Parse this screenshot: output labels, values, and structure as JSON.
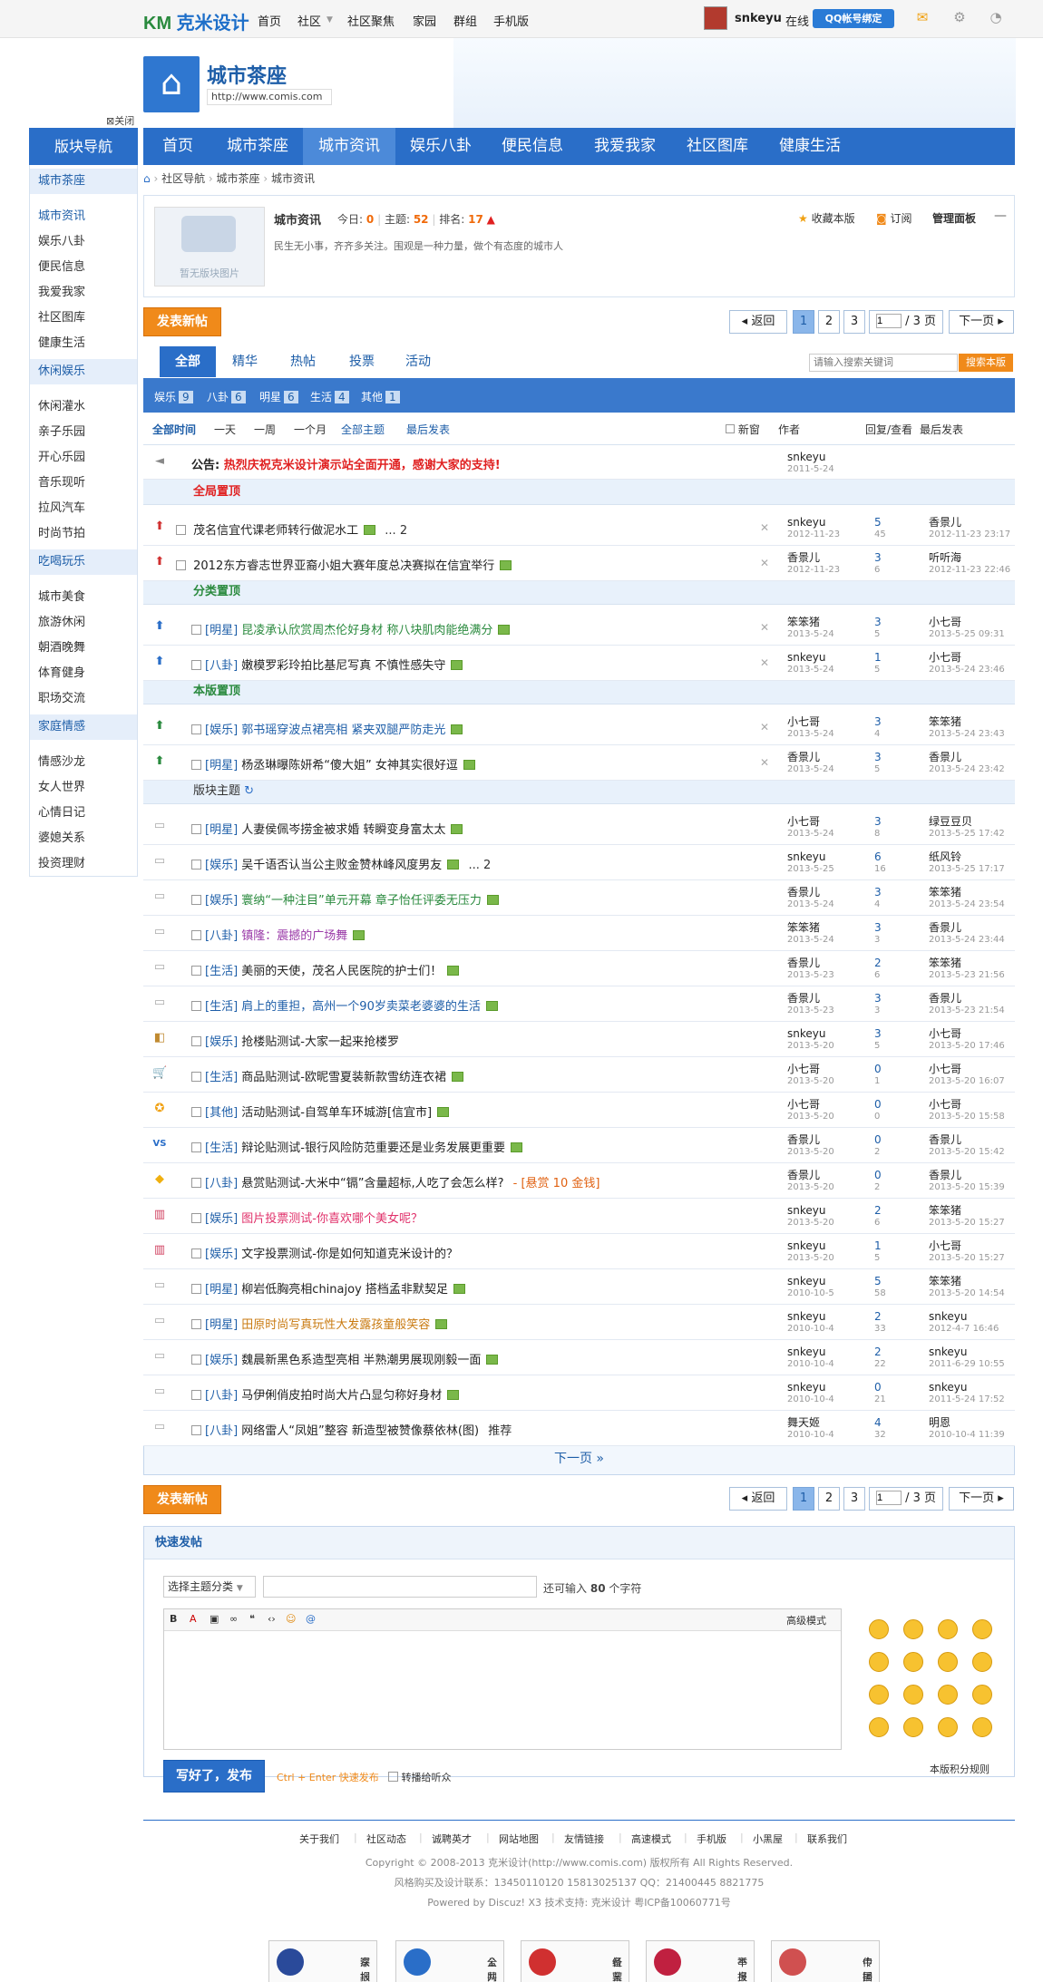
{
  "topbar": {
    "logo": "克米设计",
    "nav": [
      "首页",
      "社区",
      "社区聚焦",
      "家园",
      "群组",
      "手机版"
    ],
    "username": "snkeyu",
    "online": "在线",
    "qq_bind": "QQ帐号绑定"
  },
  "header": {
    "forum_name": "城市茶座",
    "url": "http://www.comis.com",
    "close": "关闭"
  },
  "mainnav": [
    "首页",
    "城市茶座",
    "城市资讯",
    "娱乐八卦",
    "便民信息",
    "我爱我家",
    "社区图库",
    "健康生活"
  ],
  "sidebar": {
    "title": "版块导航",
    "sections": [
      {
        "name": "城市茶座",
        "items": [
          "城市资讯",
          "娱乐八卦",
          "便民信息",
          "我爱我家",
          "社区图库",
          "健康生活"
        ]
      },
      {
        "name": "休闲娱乐",
        "items": [
          "休闲灌水",
          "亲子乐园",
          "开心乐园",
          "音乐现听",
          "拉风汽车",
          "时尚节拍"
        ]
      },
      {
        "name": "吃喝玩乐",
        "items": [
          "城市美食",
          "旅游休闲",
          "朝酒晚舞",
          "体育健身",
          "职场交流"
        ]
      },
      {
        "name": "家庭情感",
        "items": [
          "情感沙龙",
          "女人世界",
          "心情日记",
          "婆媳关系",
          "投资理财"
        ]
      }
    ]
  },
  "breadcrumb": [
    "社区导航",
    "城市茶座",
    "城市资讯"
  ],
  "info": {
    "name": "城市资讯",
    "today_label": "今日:",
    "today": "0",
    "topics_label": "主题:",
    "topics": "52",
    "rank_label": "排名:",
    "rank": "17",
    "desc": "民生无小事，齐齐多关注。围观是一种力量，做个有态度的城市人",
    "nopic": "暂无版块图片",
    "fav": "收藏本版",
    "rss": "订阅",
    "manage": "管理面板"
  },
  "toolbar": {
    "post": "发表新帖",
    "back": "返回",
    "pages": [
      "1",
      "2",
      "3"
    ],
    "page_input": "1",
    "total": "/ 3 页",
    "next": "下一页"
  },
  "tabs": [
    "全部",
    "精华",
    "热帖",
    "投票",
    "活动"
  ],
  "search": {
    "placeholder": "请输入搜索关键词",
    "button": "搜索本版"
  },
  "cats": [
    {
      "n": "娱乐",
      "c": "9"
    },
    {
      "n": "八卦",
      "c": "6"
    },
    {
      "n": "明星",
      "c": "6"
    },
    {
      "n": "生活",
      "c": "4"
    },
    {
      "n": "其他",
      "c": "1"
    }
  ],
  "filter": {
    "all_time": "全部时间",
    "d1": "一天",
    "w1": "一周",
    "m1": "一个月",
    "all_topics": "全部主题",
    "latest": "最后发表",
    "new": "新窗",
    "author": "作者",
    "reply": "回复/查看",
    "last": "最后发表"
  },
  "announce": {
    "label": "公告:",
    "text": "热烈庆祝克米设计演示站全面开通，感谢大家的支持!",
    "author": "snkeyu",
    "date": "2011-5-24"
  },
  "sections": {
    "global": "全局置顶",
    "cat": "分类置顶",
    "forum": "本版置顶",
    "normal": "版块主题"
  },
  "rows": [
    {
      "t": "",
      "title": "茂名信宜代课老师转行做泥水工",
      "extra": "... 2",
      "au": "snkeyu",
      "ad": "2012-11-23",
      "r": "5",
      "v": "45",
      "lu": "香景儿",
      "ld": "2012-11-23 23:17",
      "color": "#222"
    },
    {
      "t": "",
      "title": "2012东方睿志世界亚裔小姐大赛年度总决赛拟在信宜举行",
      "extra": "",
      "au": "香景儿",
      "ad": "2012-11-23",
      "r": "3",
      "v": "6",
      "lu": "听听海",
      "ld": "2012-11-23 22:46",
      "color": "#222"
    },
    {
      "t": "[明星]",
      "title": "昆凌承认欣赏周杰伦好身材 称八块肌肉能绝满分",
      "extra": "",
      "au": "笨笨猪",
      "ad": "2013-5-24",
      "r": "3",
      "v": "5",
      "lu": "小七哥",
      "ld": "2013-5-25 09:31",
      "color": "#2a8a3e"
    },
    {
      "t": "[八卦]",
      "title": "嫩模罗彩玲拍比基尼写真 不慎性感失守",
      "extra": "",
      "au": "snkeyu",
      "ad": "2013-5-24",
      "r": "1",
      "v": "5",
      "lu": "小七哥",
      "ld": "2013-5-24 23:46",
      "color": "#222"
    },
    {
      "t": "[娱乐]",
      "title": "郭书瑶穿波点裙亮相 紧夹双腿严防走光",
      "extra": "",
      "au": "小七哥",
      "ad": "2013-5-24",
      "r": "3",
      "v": "4",
      "lu": "笨笨猪",
      "ld": "2013-5-24 23:43",
      "color": "#1e5ea8"
    },
    {
      "t": "[明星]",
      "title": "杨丞琳曝陈妍希“傻大姐” 女神其实很好逗",
      "extra": "",
      "au": "香景儿",
      "ad": "2013-5-24",
      "r": "3",
      "v": "5",
      "lu": "香景儿",
      "ld": "2013-5-24 23:42",
      "color": "#222"
    },
    {
      "t": "[明星]",
      "title": "人妻侯佩岑捞金被求婚 转瞬变身富太太",
      "extra": "",
      "au": "小七哥",
      "ad": "2013-5-24",
      "r": "3",
      "v": "8",
      "lu": "绿豆豆贝",
      "ld": "2013-5-25 17:42",
      "color": "#222"
    },
    {
      "t": "[娱乐]",
      "title": "吴千语否认当公主败金赞林峰风度男友",
      "extra": "... 2",
      "au": "snkeyu",
      "ad": "2013-5-25",
      "r": "6",
      "v": "16",
      "lu": "纸风铃",
      "ld": "2013-5-25 17:17",
      "color": "#222"
    },
    {
      "t": "[娱乐]",
      "title": "寰纳“一种注目”单元开幕 章子怡任评委无压力",
      "extra": "",
      "au": "香景儿",
      "ad": "2013-5-24",
      "r": "3",
      "v": "4",
      "lu": "笨笨猪",
      "ld": "2013-5-24 23:54",
      "color": "#2a8a3e"
    },
    {
      "t": "[八卦]",
      "title": "镇隆：震撼的广场舞",
      "extra": "",
      "au": "笨笨猪",
      "ad": "2013-5-24",
      "r": "3",
      "v": "3",
      "lu": "香景儿",
      "ld": "2013-5-24 23:44",
      "color": "#9a3aa8"
    },
    {
      "t": "[生活]",
      "title": "美丽的天使，茂名人民医院的护士们！",
      "extra": "",
      "au": "香景儿",
      "ad": "2013-5-23",
      "r": "2",
      "v": "6",
      "lu": "笨笨猪",
      "ld": "2013-5-23 21:56",
      "color": "#222"
    },
    {
      "t": "[生活]",
      "title": "肩上的重担，高州一个90岁卖菜老婆婆的生活",
      "extra": "",
      "au": "香景儿",
      "ad": "2013-5-23",
      "r": "3",
      "v": "3",
      "lu": "香景儿",
      "ld": "2013-5-23 21:54",
      "color": "#1e5ea8"
    },
    {
      "t": "[娱乐]",
      "title": "抢楼贴测试-大家一起来抢楼罗",
      "extra": "",
      "au": "snkeyu",
      "ad": "2013-5-20",
      "r": "3",
      "v": "5",
      "lu": "小七哥",
      "ld": "2013-5-20 17:46",
      "color": "#222"
    },
    {
      "t": "[生活]",
      "title": "商品贴测试-欧昵雪夏装新款雪纺连衣裙",
      "extra": "",
      "au": "小七哥",
      "ad": "2013-5-20",
      "r": "0",
      "v": "1",
      "lu": "小七哥",
      "ld": "2013-5-20 16:07",
      "color": "#222"
    },
    {
      "t": "[其他]",
      "title": "活动贴测试-自驾单车环城游[信宜市]",
      "extra": "",
      "au": "小七哥",
      "ad": "2013-5-20",
      "r": "0",
      "v": "0",
      "lu": "小七哥",
      "ld": "2013-5-20 15:58",
      "color": "#222"
    },
    {
      "t": "[生活]",
      "title": "辩论贴测试-银行风险防范重要还是业务发展更重要",
      "extra": "",
      "au": "香景儿",
      "ad": "2013-5-20",
      "r": "0",
      "v": "2",
      "lu": "香景儿",
      "ld": "2013-5-20 15:42",
      "color": "#222"
    },
    {
      "t": "[八卦]",
      "title": "悬赏贴测试-大米中“镉”含量超标,人吃了会怎么样?",
      "extra": "- [悬赏 10 金钱]",
      "au": "香景儿",
      "ad": "2013-5-20",
      "r": "0",
      "v": "2",
      "lu": "香景儿",
      "ld": "2013-5-20 15:39",
      "color": "#222"
    },
    {
      "t": "[娱乐]",
      "title": "图片投票测试-你喜欢哪个美女呢？",
      "extra": "",
      "au": "snkeyu",
      "ad": "2013-5-20",
      "r": "2",
      "v": "6",
      "lu": "笨笨猪",
      "ld": "2013-5-20 15:27",
      "color": "#e0306a"
    },
    {
      "t": "[娱乐]",
      "title": "文字投票测试-你是如何知道克米设计的？",
      "extra": "",
      "au": "snkeyu",
      "ad": "2013-5-20",
      "r": "1",
      "v": "5",
      "lu": "小七哥",
      "ld": "2013-5-20 15:27",
      "color": "#222"
    },
    {
      "t": "[明星]",
      "title": "柳岩低胸亮相chinajoy 搭档孟非默契足",
      "extra": "",
      "au": "snkeyu",
      "ad": "2010-10-5",
      "r": "5",
      "v": "58",
      "lu": "笨笨猪",
      "ld": "2013-5-20 14:54",
      "color": "#222"
    },
    {
      "t": "[明星]",
      "title": "田原时尚写真玩性大发露孩童般笑容",
      "extra": "",
      "au": "snkeyu",
      "ad": "2010-10-4",
      "r": "2",
      "v": "33",
      "lu": "snkeyu",
      "ld": "2012-4-7 16:46",
      "color": "#c97a10"
    },
    {
      "t": "[娱乐]",
      "title": "魏晨新黑色系造型亮相 半熟潮男展现刚毅一面",
      "extra": "",
      "au": "snkeyu",
      "ad": "2010-10-4",
      "r": "2",
      "v": "22",
      "lu": "snkeyu",
      "ld": "2011-6-29 10:55",
      "color": "#222"
    },
    {
      "t": "[八卦]",
      "title": "马伊俐俏皮拍时尚大片凸显匀称好身材",
      "extra": "",
      "au": "snkeyu",
      "ad": "2010-10-4",
      "r": "0",
      "v": "21",
      "lu": "snkeyu",
      "ld": "2011-5-24 17:52",
      "color": "#222"
    },
    {
      "t": "[八卦]",
      "title": "网络雷人“凤姐”整容 新造型被赞像蔡依林(图)",
      "extra": "推荐",
      "au": "舞天姬",
      "ad": "2010-10-4",
      "r": "4",
      "v": "32",
      "lu": "明恩",
      "ld": "2010-10-4 11:39",
      "color": "#222"
    }
  ],
  "next_page": "下一页 »",
  "quickpost": {
    "title": "快速发帖",
    "cat": "选择主题分类",
    "count_pre": "还可输入",
    "count": "80",
    "count_post": "个字符",
    "advanced": "高级模式",
    "submit": "写好了，发布",
    "hint": "Ctrl + Enter 快速发布",
    "broadcast": "转播给听众",
    "rules": "本版积分规则"
  },
  "footer": {
    "links": [
      "关于我们",
      "社区动态",
      "诚聘英才",
      "网站地图",
      "友情链接",
      "高速模式",
      "手机版",
      "小黑屋",
      "联系我们"
    ],
    "copy": "Copyright © 2008-2013 克米设计(http://www.comis.com) 版权所有 All Rights Reserved.",
    "contact": "风格购买及设计联系：13450110120 15813025137 QQ：21400445 8821775",
    "powered": "Powered by Discuz! X3  技术支持: 克米设计 粤ICP备10060771号",
    "badges": [
      {
        "a": "深圳网络警",
        "b": "察报警平台"
      },
      {
        "a": "公共信息安",
        "b": "全网络监察"
      },
      {
        "a": "经营性网站",
        "b": "备案信息"
      },
      {
        "a": "不良信息",
        "b": "举报中心"
      },
      {
        "a": "中国文明网",
        "b": "传播文明"
      }
    ]
  }
}
